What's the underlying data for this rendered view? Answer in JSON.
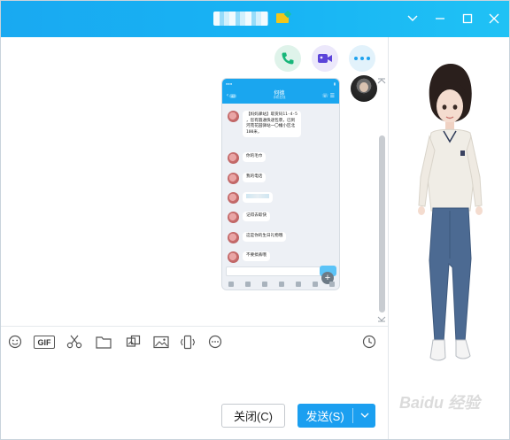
{
  "window": {
    "contact_name_blurred": "",
    "controls": [
      "chevron-down-icon",
      "minimize-icon",
      "maximize-icon",
      "close-icon"
    ]
  },
  "call_actions": [
    "phone-icon",
    "video-icon",
    "more-icon"
  ],
  "shared_screenshot": {
    "chat_title": "何德",
    "chat_subtitle": "手机在线",
    "unread": "42",
    "messages": [
      {
        "text": "【妈妈驿站】取货码11-4-5\n，您有圆通快递包裹，已到\n河苑花园驿站一〇幢小区北\n100米，"
      },
      {
        "text": "你的毛巾"
      },
      {
        "text": "我的电话"
      },
      {
        "text": ""
      },
      {
        "text": "记得去取快"
      },
      {
        "text": "这是你的生日礼物哦"
      },
      {
        "text": "不要搞丢哦"
      }
    ],
    "colors": {
      "header": "#1aa6ef",
      "bg": "#edf0f5"
    }
  },
  "toolbar": {
    "icons": [
      "emoji-icon",
      "gif-icon",
      "scissors-icon",
      "folder-icon",
      "image-crop-icon",
      "picture-icon",
      "screen-shake-icon",
      "more-options-icon",
      "history-clock-icon"
    ],
    "gif_label": "GIF"
  },
  "footer": {
    "close_label": "关闭(C)",
    "send_label": "发送(S)"
  },
  "watermark": "Baidu 经验",
  "colors": {
    "titlebar": "#19a9f1",
    "send": "#1b9ff0"
  }
}
